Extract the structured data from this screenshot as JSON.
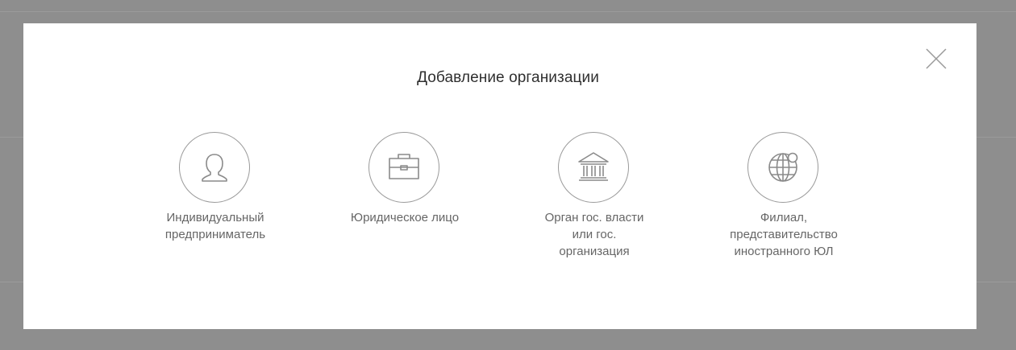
{
  "dialog": {
    "title": "Добавление организации",
    "close_icon": "close-icon"
  },
  "options": [
    {
      "icon": "person-icon",
      "label_lines": [
        "Индивидуальный",
        "предприниматель"
      ]
    },
    {
      "icon": "briefcase-icon",
      "label_lines": [
        "Юридическое лицо"
      ]
    },
    {
      "icon": "government-building-icon",
      "label_lines": [
        "Орган гос. власти",
        "или гос.",
        "организация"
      ]
    },
    {
      "icon": "globe-icon",
      "label_lines": [
        "Филиал,",
        "представительство",
        "иностранного ЮЛ"
      ]
    }
  ],
  "colors": {
    "overlay": "#8e8e8e",
    "modal_background": "#ffffff",
    "title_text": "#2f2f2f",
    "label_text": "#666666",
    "icon_stroke": "#9a9a9a"
  }
}
